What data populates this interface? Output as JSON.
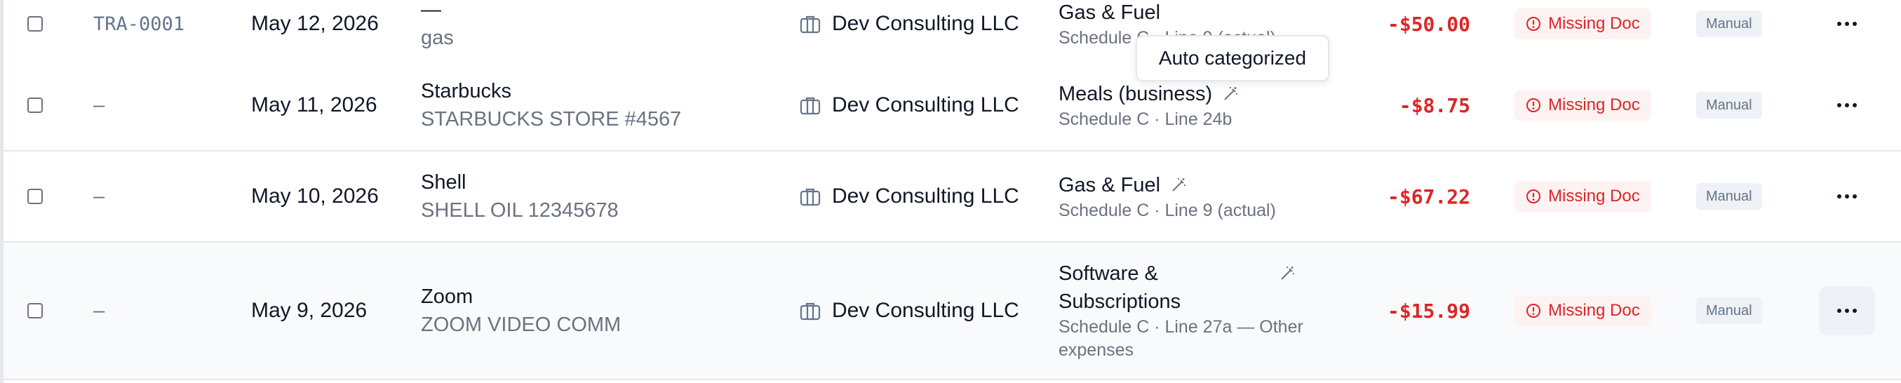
{
  "rows": [
    {
      "ref": "TRA-0001",
      "date": "May 12, 2026",
      "title": "—",
      "subtitle": "gas",
      "entity": "Dev Consulting LLC",
      "category": "Gas & Fuel",
      "schedule": "Schedule C · Line 9 (actual)",
      "amount": "-$50.00",
      "status": "Missing Doc",
      "source": "Manual"
    },
    {
      "ref": "–",
      "date": "May 11, 2026",
      "title": "Starbucks",
      "subtitle": "STARBUCKS STORE #4567",
      "entity": "Dev Consulting LLC",
      "category": "Meals (business)",
      "schedule": "Schedule C · Line 24b",
      "amount": "-$8.75",
      "status": "Missing Doc",
      "source": "Manual"
    },
    {
      "ref": "–",
      "date": "May 10, 2026",
      "title": "Shell",
      "subtitle": "SHELL OIL 12345678",
      "entity": "Dev Consulting LLC",
      "category": "Gas & Fuel",
      "schedule": "Schedule C · Line 9 (actual)",
      "amount": "-$67.22",
      "status": "Missing Doc",
      "source": "Manual"
    },
    {
      "ref": "–",
      "date": "May 9, 2026",
      "title": "Zoom",
      "subtitle": "ZOOM VIDEO COMM",
      "entity": "Dev Consulting LLC",
      "category_line1": "Software &",
      "category_line2": "Subscriptions",
      "schedule_line1": "Schedule C · Line 27a — Other",
      "schedule_line2": "expenses",
      "amount": "-$15.99",
      "status": "Missing Doc",
      "source": "Manual"
    }
  ],
  "tooltip": "Auto categorized",
  "icons": {
    "entity": "briefcase-icon",
    "auto": "magic-wand-icon",
    "status": "alert-circle-icon",
    "more": "more-horizontal-icon"
  },
  "colors": {
    "negative": "#dc2626",
    "badge_bg": "#fef2f2"
  }
}
